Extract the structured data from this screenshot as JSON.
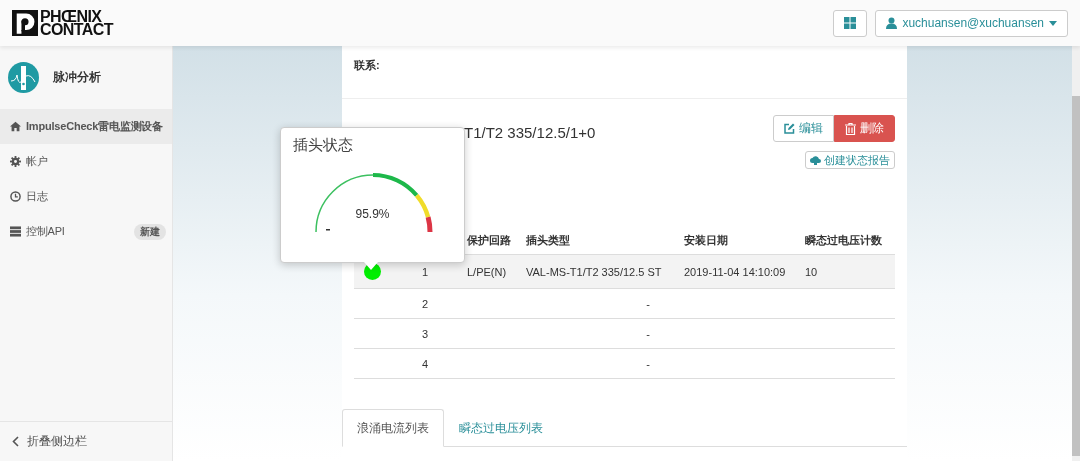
{
  "header": {
    "logo_lines": [
      "PHŒNIX",
      "CONTACT"
    ],
    "user": "xuchuansen@xuchuansen"
  },
  "sidebar": {
    "app_name": "脉冲分析",
    "items": [
      {
        "label": "ImpulseCheck雷电监测设备",
        "selected": true
      },
      {
        "label": "帐户",
        "selected": false
      },
      {
        "label": "日志",
        "selected": false
      },
      {
        "label": "控制API",
        "selected": false,
        "badge": "新建"
      }
    ],
    "collapse": "折叠侧边栏"
  },
  "card": {
    "contact_label": "联系:",
    "title": "T1/T2 335/12.5/1+0",
    "edit": "编辑",
    "delete": "删除",
    "report": "创建状态报告"
  },
  "table": {
    "columns": [
      "保护回路",
      "插头类型",
      "安装日期",
      "瞬态过电压计数"
    ],
    "rows": [
      {
        "number": "1",
        "color": "#00ee00",
        "cells": [
          "L/PE(N)",
          "VAL-MS-T1/T2 335/12.5 ST",
          "2019-11-04 14:10:09",
          "10"
        ],
        "selected": true
      },
      {
        "number": "2",
        "cells": [
          "-"
        ],
        "selected": false
      },
      {
        "number": "3",
        "cells": [
          "-"
        ],
        "selected": false
      },
      {
        "number": "4",
        "cells": [
          "-"
        ],
        "selected": false
      }
    ]
  },
  "tabs": [
    {
      "label": "浪涌电流列表",
      "selected": true
    },
    {
      "label": "瞬态过电压列表",
      "selected": false
    }
  ],
  "popover": {
    "title": "插头状态",
    "reading": "95.9%"
  }
}
